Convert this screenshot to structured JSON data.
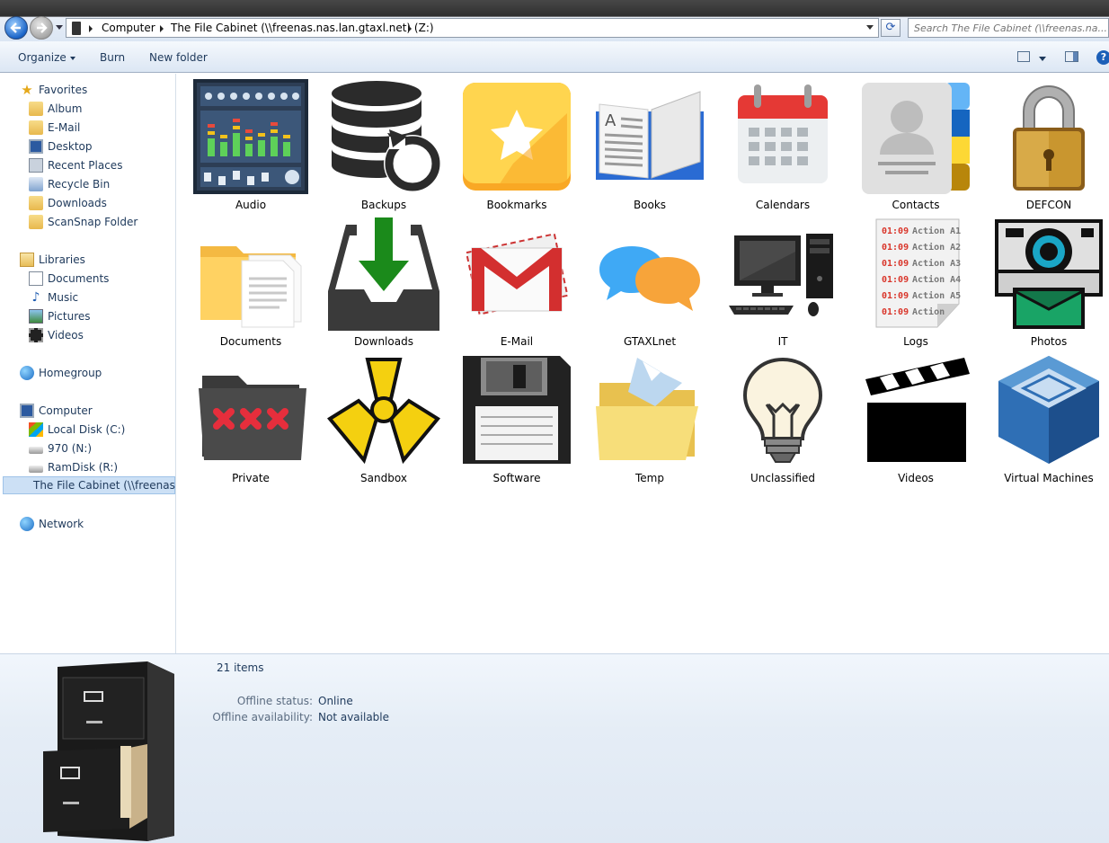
{
  "address": {
    "crumbs": [
      "Computer",
      "The File Cabinet (\\\\freenas.nas.lan.gtaxl.net) (Z:)"
    ],
    "search_placeholder": "Search The File Cabinet (\\\\freenas.na..."
  },
  "toolbar": {
    "organize": "Organize",
    "burn": "Burn",
    "new_folder": "New folder",
    "help": "?"
  },
  "nav": {
    "favorites": "Favorites",
    "favorite_items": [
      "Album",
      "E-Mail",
      "Desktop",
      "Recent Places",
      "Recycle Bin",
      "Downloads",
      "ScanSnap Folder"
    ],
    "libraries": "Libraries",
    "library_items": [
      "Documents",
      "Music",
      "Pictures",
      "Videos"
    ],
    "homegroup": "Homegroup",
    "computer": "Computer",
    "computer_items": [
      "Local Disk (C:)",
      "970 (N:)",
      "RamDisk (R:)",
      "The File Cabinet (\\\\freenas"
    ],
    "network": "Network"
  },
  "folders": [
    "Audio",
    "Backups",
    "Bookmarks",
    "Books",
    "Calendars",
    "Contacts",
    "DEFCON",
    "Documents",
    "Downloads",
    "E-Mail",
    "GTAXLnet",
    "IT",
    "Logs",
    "Photos",
    "Private",
    "Sandbox",
    "Software",
    "Temp",
    "Unclassified",
    "Videos",
    "Virtual Machines"
  ],
  "details": {
    "count": "21 items",
    "offline_status_label": "Offline status:",
    "offline_status_value": "Online",
    "offline_availability_label": "Offline availability:",
    "offline_availability_value": "Not available"
  }
}
